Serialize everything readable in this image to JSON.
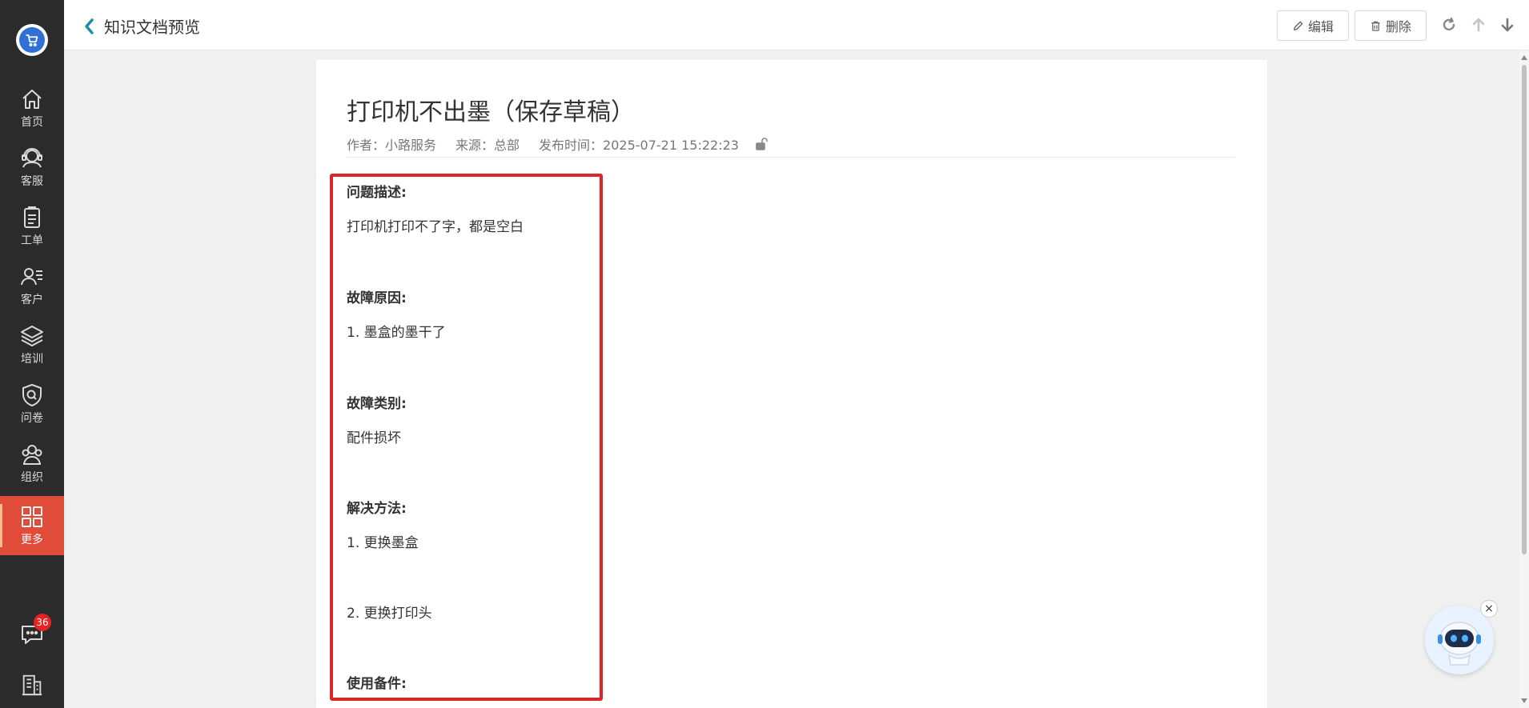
{
  "sidebar": {
    "logo_icon": "shopping-cart-icon",
    "items": [
      {
        "label": "首页",
        "icon": "home-icon"
      },
      {
        "label": "客服",
        "icon": "headset-icon"
      },
      {
        "label": "工单",
        "icon": "clipboard-icon"
      },
      {
        "label": "客户",
        "icon": "customer-list-icon"
      },
      {
        "label": "培训",
        "icon": "layers-icon"
      },
      {
        "label": "问卷",
        "icon": "shield-search-icon"
      },
      {
        "label": "组织",
        "icon": "group-icon"
      },
      {
        "label": "更多",
        "icon": "grid-icon",
        "active": true
      }
    ],
    "chat_badge": "36"
  },
  "header": {
    "title": "知识文档预览",
    "edit_label": "编辑",
    "delete_label": "删除"
  },
  "doc": {
    "title": "打印机不出墨（保存草稿）",
    "author": "作者：小路服务",
    "source": "来源：总部",
    "published": "发布时间：2025-07-21 15:22:23",
    "sections": {
      "problem_label": "问题描述:",
      "problem_text": "打印机打印不了字，都是空白",
      "cause_label": "故障原因:",
      "cause_text": "1. 墨盒的墨干了",
      "category_label": "故障类别:",
      "category_text": "配件损坏",
      "solution_label": "解决方法:",
      "solution_1": "1. 更换墨盒",
      "solution_2": "2. 更换打印头",
      "parts_label": "使用备件:"
    }
  },
  "colors": {
    "sidebar_bg": "#2b2b2b",
    "active_nav": "#e04b3a",
    "highlight_border": "#dc2626",
    "back_chevron": "#1a8fa6"
  },
  "assistant": {
    "close_label": "×"
  }
}
